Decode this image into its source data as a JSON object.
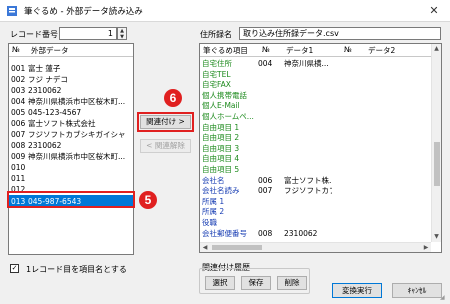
{
  "window": {
    "title": "筆ぐるめ - 外部データ読み込み",
    "close": "✕"
  },
  "left": {
    "record_label": "レコード番号",
    "record_value": "1",
    "list_header": {
      "col1": "№",
      "col2": "外部データ"
    },
    "rows": [
      {
        "no": "001",
        "text": "富士 蓮子"
      },
      {
        "no": "002",
        "text": "フジ ナデコ"
      },
      {
        "no": "003",
        "text": "2310062"
      },
      {
        "no": "004",
        "text": "神奈川県横浜市中区桜木町..."
      },
      {
        "no": "005",
        "text": "045-123-4567"
      },
      {
        "no": "006",
        "text": "富士ソフト株式会社"
      },
      {
        "no": "007",
        "text": "フジソフトカブシキガイシャ"
      },
      {
        "no": "008",
        "text": "2310062"
      },
      {
        "no": "009",
        "text": "神奈川県横浜市中区桜木町..."
      },
      {
        "no": "010",
        "text": ""
      },
      {
        "no": "011",
        "text": ""
      },
      {
        "no": "012",
        "text": ""
      }
    ],
    "selected_row": {
      "no": "013",
      "text": "045-987-6543"
    },
    "checkbox_label": "1レコード目を項目名とする",
    "checkbox_mark": "✓"
  },
  "middle": {
    "assoc_button": "関連付け >",
    "unassoc_button": "< 関連解除"
  },
  "right": {
    "file_label": "住所録名",
    "file_value": "取り込み住所録データ.csv",
    "header": {
      "item": "筆ぐるめ項目",
      "no1": "№",
      "data1": "データ1",
      "no2": "№",
      "data2": "データ2"
    },
    "rows": [
      {
        "item": "自宅住所",
        "no": "004",
        "data": "神奈川県横...",
        "color": "green"
      },
      {
        "item": "自宅TEL",
        "no": "",
        "data": "",
        "color": "green"
      },
      {
        "item": "自宅FAX",
        "no": "",
        "data": "",
        "color": "green"
      },
      {
        "item": "個人携帯電話",
        "no": "",
        "data": "",
        "color": "green"
      },
      {
        "item": "個人E-Mail",
        "no": "",
        "data": "",
        "color": "green"
      },
      {
        "item": "個人ホームペ...",
        "no": "",
        "data": "",
        "color": "green"
      },
      {
        "item": "自由項目 1",
        "no": "",
        "data": "",
        "color": "green"
      },
      {
        "item": "自由項目 2",
        "no": "",
        "data": "",
        "color": "green"
      },
      {
        "item": "自由項目 3",
        "no": "",
        "data": "",
        "color": "green"
      },
      {
        "item": "自由項目 4",
        "no": "",
        "data": "",
        "color": "green"
      },
      {
        "item": "自由項目 5",
        "no": "",
        "data": "",
        "color": "green"
      },
      {
        "item": "会社名",
        "no": "006",
        "data": "富士ソフト株...",
        "color": "blue"
      },
      {
        "item": "会社名読み",
        "no": "007",
        "data": "フジソフトカブシ...",
        "color": "blue"
      },
      {
        "item": "所属 1",
        "no": "",
        "data": "",
        "color": "blue"
      },
      {
        "item": "所属 2",
        "no": "",
        "data": "",
        "color": "blue"
      },
      {
        "item": "役職",
        "no": "",
        "data": "",
        "color": "blue"
      },
      {
        "item": "会社郵便番号",
        "no": "008",
        "data": "2310062",
        "color": "blue"
      }
    ]
  },
  "history": {
    "label": "関連付け履歴",
    "select": "選択",
    "save": "保存",
    "delete": "削除"
  },
  "actions": {
    "convert": "変換実行",
    "cancel": "ｷｬﾝｾﾙ"
  },
  "annotations": {
    "badge6": "6",
    "badge5": "5"
  },
  "colors": {
    "selection": "#0078d7",
    "highlight": "#e02020",
    "item_green": "#1c8a1c",
    "item_blue": "#1a3fb4"
  }
}
